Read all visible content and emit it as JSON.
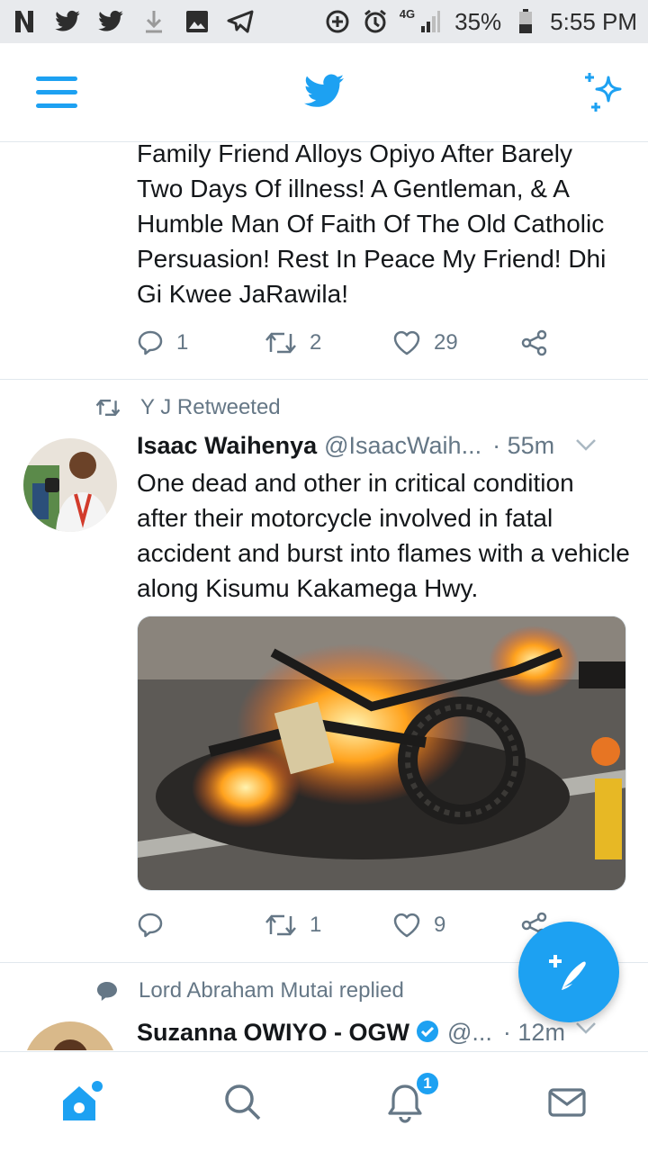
{
  "status_bar": {
    "signal": "4G",
    "battery": "35%",
    "time": "5:55 PM"
  },
  "app": {
    "accent": "#1da1f2"
  },
  "tweets": [
    {
      "text": "Family Friend Alloys Opiyo After Barely Two Days Of illness!  A Gentleman, & A Humble Man Of Faith Of The Old Catholic Persuasion! Rest In Peace My Friend! Dhi Gi Kwee JaRawila!",
      "replies": "1",
      "retweets": "2",
      "likes": "29"
    },
    {
      "context": "Y J Retweeted",
      "name": "Isaac Waihenya",
      "handle": "@IsaacWaih...",
      "time": "· 55m",
      "text": "One dead and other in critical condition after their motorcycle involved in fatal accident and burst into flames with a vehicle along Kisumu Kakamega Hwy.",
      "replies": "",
      "retweets": "1",
      "likes": "9"
    },
    {
      "context": "Lord Abraham Mutai replied",
      "name": "Suzanna OWIYO - OGW",
      "handle": "@...",
      "time": "· 12m"
    }
  ],
  "notifications_badge": "1"
}
